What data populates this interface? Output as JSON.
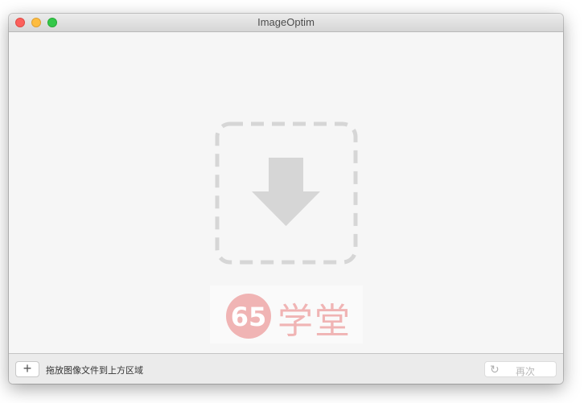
{
  "window": {
    "title": "ImageOptim"
  },
  "dropzone": {
    "icon": "download-arrow-icon"
  },
  "watermark": {
    "number": "65",
    "text": "学堂"
  },
  "bottom_bar": {
    "add_label": "+",
    "hint": "拖放图像文件到上方区域",
    "again_label": "再次",
    "again_icon": "refresh-icon"
  },
  "colors": {
    "close": "#fc605c",
    "minimize": "#fdbc40",
    "maximize": "#34c84a",
    "dropzone": "#d6d6d6",
    "watermark": "#f0b4b4"
  }
}
